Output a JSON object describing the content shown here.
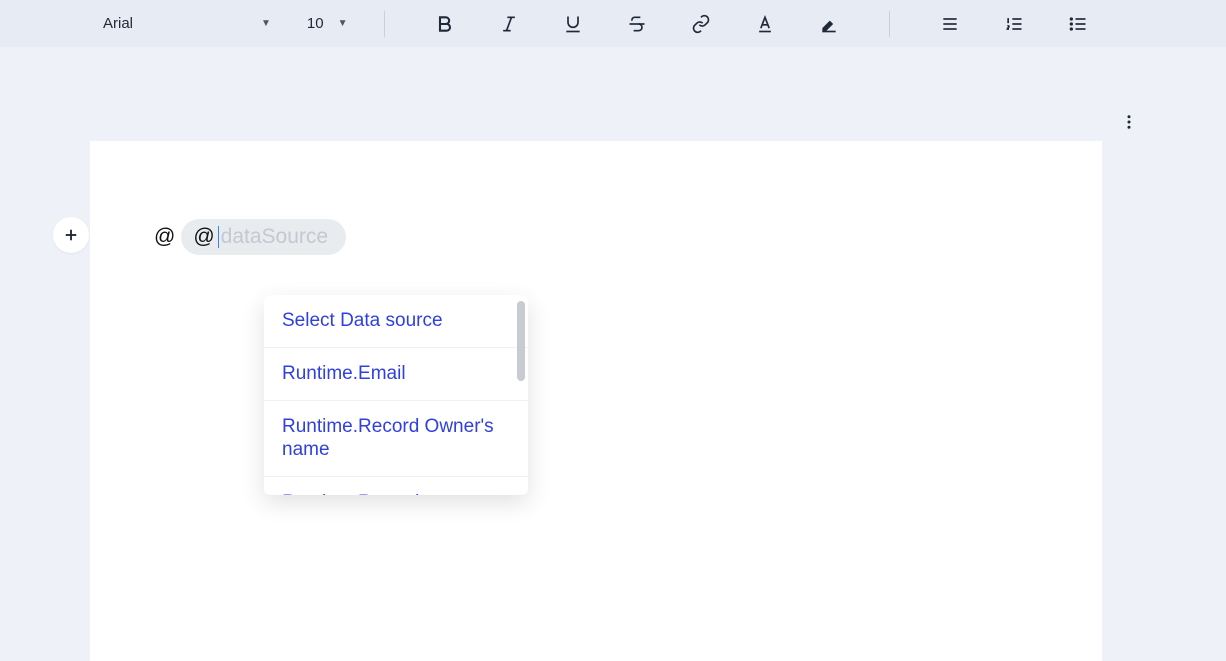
{
  "toolbar": {
    "font": "Arial",
    "size": "10"
  },
  "content": {
    "prefix": "@",
    "chip_prefix": "@",
    "chip_placeholder": "dataSource"
  },
  "dropdown": {
    "items": [
      "Select Data source",
      "Runtime.Email",
      "Runtime.Record Owner's name",
      "Runtime.Record"
    ]
  }
}
